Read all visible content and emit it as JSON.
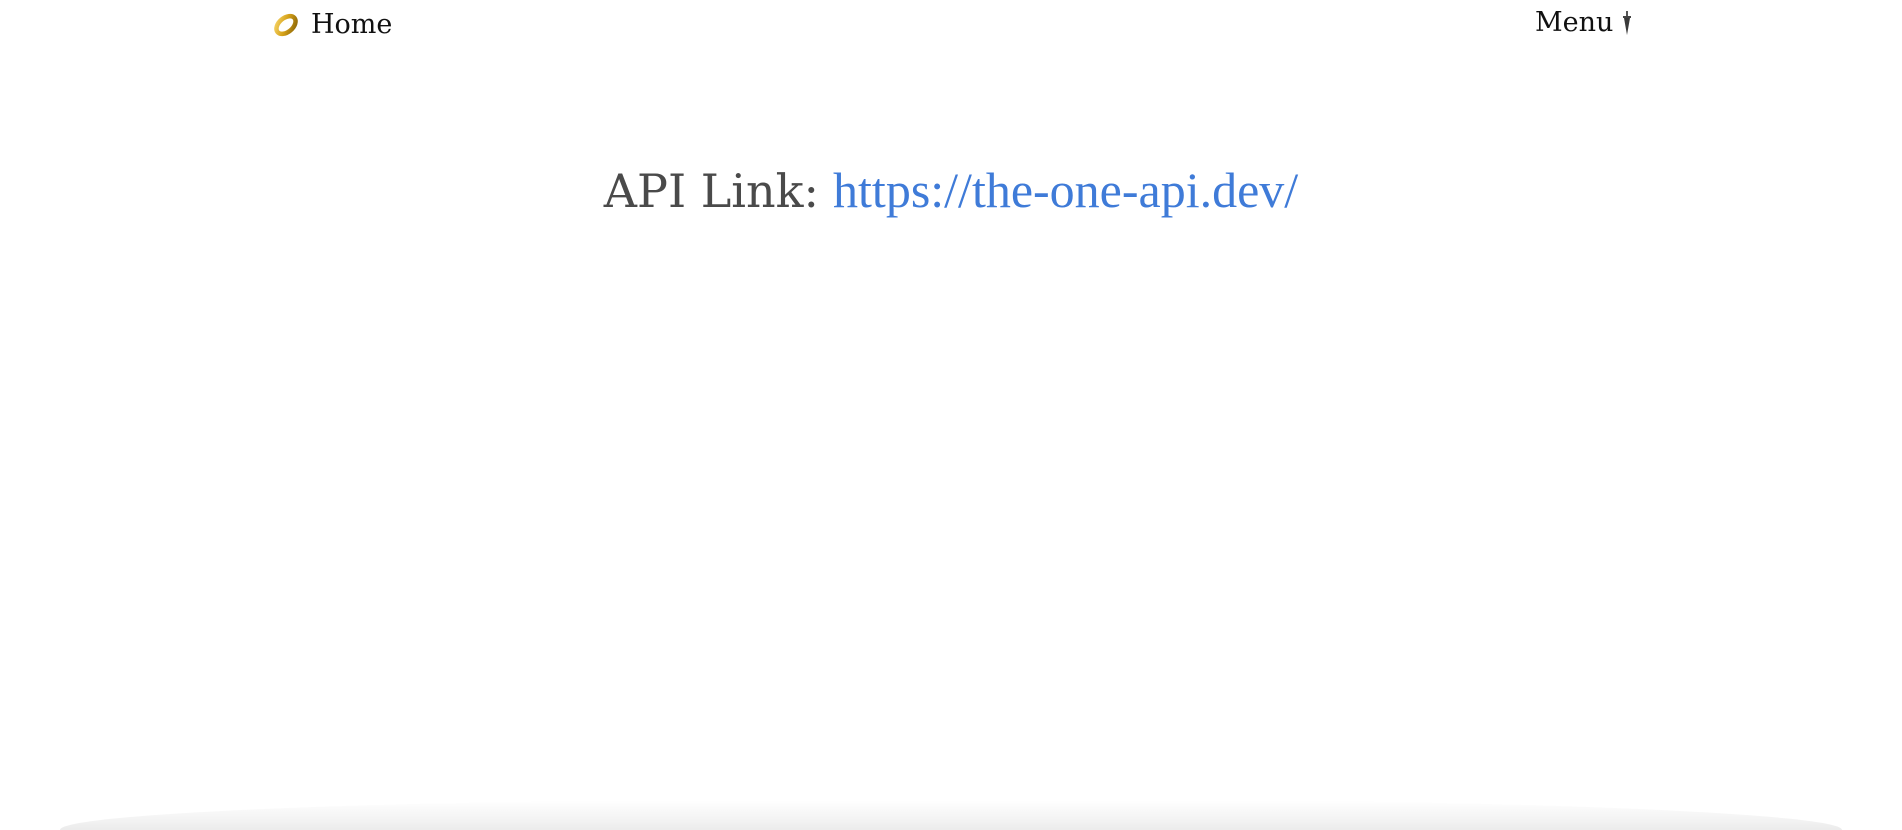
{
  "nav": {
    "home_label": "Home",
    "home_icon": "ring-icon",
    "menu_label": "Menu",
    "menu_icon": "dagger-icon"
  },
  "main": {
    "api_label": "API Link:",
    "api_url": "https://the-one-api.dev/"
  },
  "colors": {
    "link": "#3f7bd8",
    "label": "#4a4a4a",
    "ring_gold": "#d4a017"
  }
}
